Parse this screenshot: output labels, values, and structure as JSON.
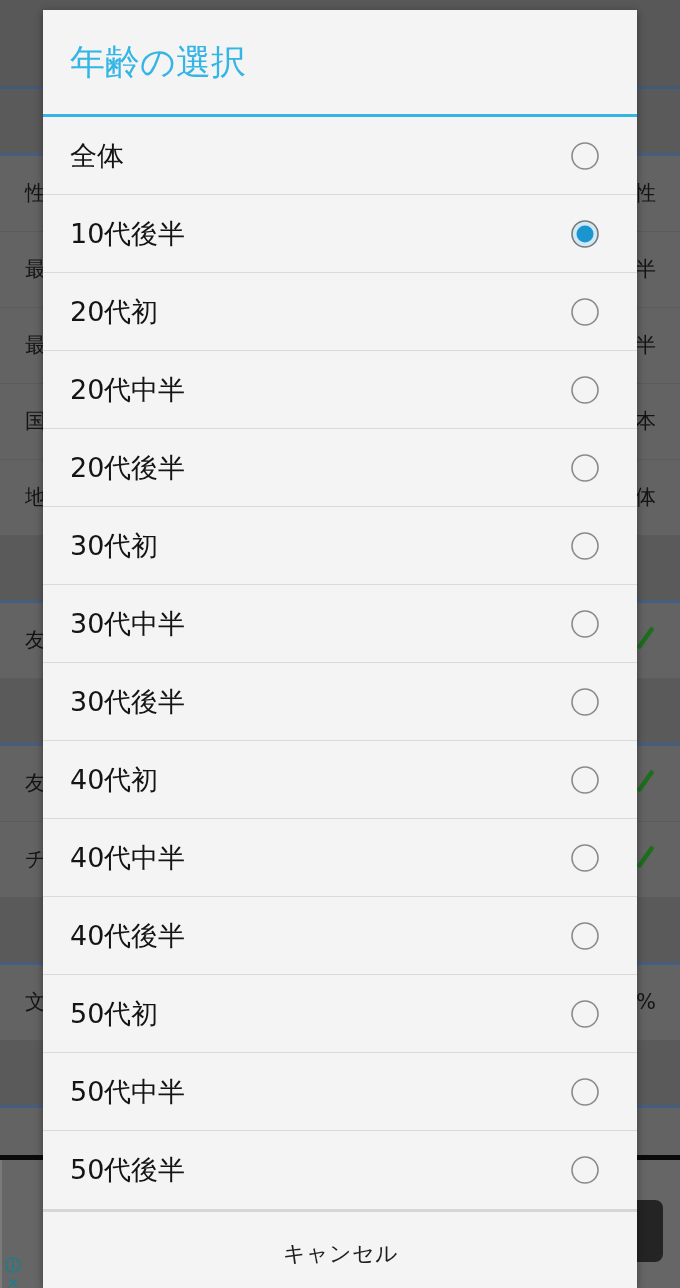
{
  "background": {
    "sections": [
      {
        "rows": [
          {
            "kind": "value",
            "label": "性",
            "value": "性"
          },
          {
            "kind": "value",
            "label": "最",
            "value": "半"
          },
          {
            "kind": "value",
            "label": "最",
            "value": "半"
          },
          {
            "kind": "value",
            "label": "国",
            "value": "本"
          },
          {
            "kind": "value",
            "label": "地",
            "value": "体"
          }
        ]
      },
      {
        "rows": [
          {
            "kind": "check",
            "label": "友",
            "checked": true
          }
        ]
      },
      {
        "rows": [
          {
            "kind": "check",
            "label": "友",
            "checked": true
          },
          {
            "kind": "check",
            "label": "チ",
            "checked": true
          }
        ]
      },
      {
        "rows": [
          {
            "kind": "value",
            "label": "文",
            "value": "%"
          }
        ]
      }
    ]
  },
  "dialog": {
    "title": "年齢の選択",
    "options": [
      {
        "label": "全体",
        "selected": false
      },
      {
        "label": "10代後半",
        "selected": true
      },
      {
        "label": "20代初",
        "selected": false
      },
      {
        "label": "20代中半",
        "selected": false
      },
      {
        "label": "20代後半",
        "selected": false
      },
      {
        "label": "30代初",
        "selected": false
      },
      {
        "label": "30代中半",
        "selected": false
      },
      {
        "label": "30代後半",
        "selected": false
      },
      {
        "label": "40代初",
        "selected": false
      },
      {
        "label": "40代中半",
        "selected": false
      },
      {
        "label": "40代後半",
        "selected": false
      },
      {
        "label": "50代初",
        "selected": false
      },
      {
        "label": "50代中半",
        "selected": false
      },
      {
        "label": "50代後半",
        "selected": false
      }
    ],
    "cancel_button": "キャンセル"
  }
}
